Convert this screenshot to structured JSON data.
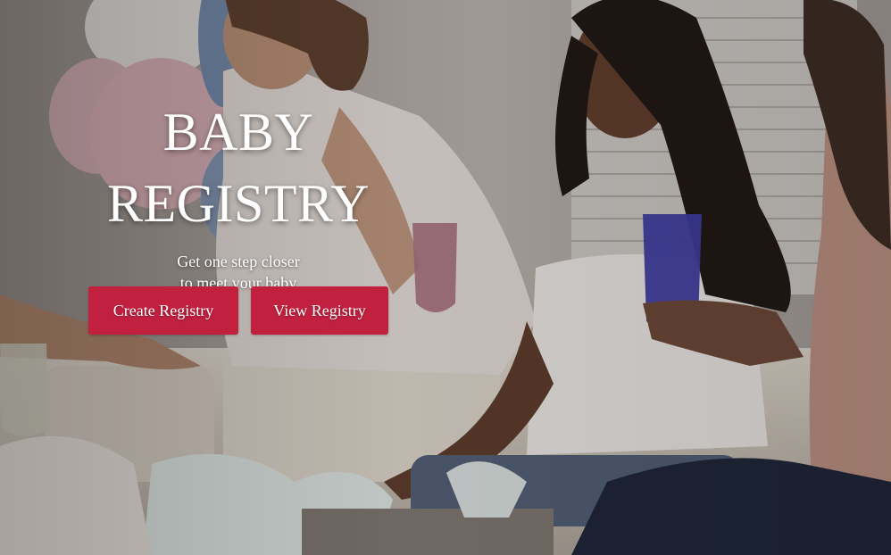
{
  "hero": {
    "title_line1": "BABY",
    "title_line2": "REGISTRY",
    "subtitle_line1": "Get one step closer",
    "subtitle_line2": "to meet your baby",
    "background_image": "baby-shower-party-photo"
  },
  "buttons": {
    "create_label": "Create Registry",
    "view_label": "View Registry"
  },
  "colors": {
    "button_background": "#c1203f",
    "text": "#ffffff"
  }
}
